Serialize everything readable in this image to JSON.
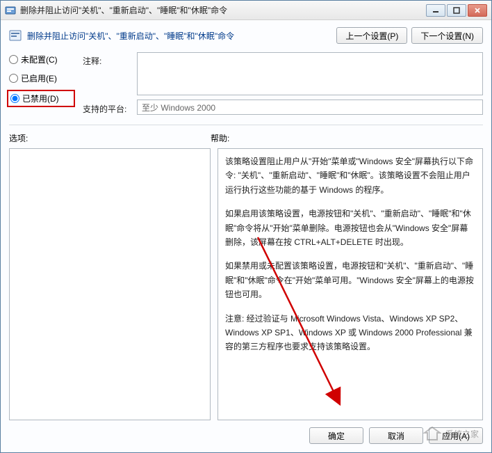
{
  "titlebar": {
    "text": "删除并阻止访问\"关机\"、\"重新启动\"、\"睡眠\"和\"休眠\"命令"
  },
  "header": {
    "title": "删除并阻止访问\"关机\"、\"重新启动\"、\"睡眠\"和\"休眠\"命令",
    "prev_btn": "上一个设置(P)",
    "next_btn": "下一个设置(N)"
  },
  "radios": {
    "not_configured": "未配置(C)",
    "enabled": "已启用(E)",
    "disabled": "已禁用(D)",
    "selected": "disabled"
  },
  "labels": {
    "comment": "注释:",
    "platform": "支持的平台:",
    "options": "选项:",
    "help": "帮助:"
  },
  "platform_value": "至少 Windows 2000",
  "help_paragraphs": [
    "该策略设置阻止用户从\"开始\"菜单或\"Windows 安全\"屏幕执行以下命令: \"关机\"、\"重新启动\"、\"睡眠\"和\"休眠\"。该策略设置不会阻止用户运行执行这些功能的基于 Windows 的程序。",
    "如果启用该策略设置，电源按钮和\"关机\"、\"重新启动\"、\"睡眠\"和\"休眠\"命令将从\"开始\"菜单删除。电源按钮也会从\"Windows 安全\"屏幕删除，该屏幕在按 CTRL+ALT+DELETE 时出现。",
    "如果禁用或未配置该策略设置，电源按钮和\"关机\"、\"重新启动\"、\"睡眠\"和\"休眠\"命令在\"开始\"菜单可用。\"Windows 安全\"屏幕上的电源按钮也可用。",
    "注意: 经过验证与 Microsoft Windows Vista、Windows XP SP2、Windows XP SP1、Windows XP 或 Windows 2000 Professional 兼容的第三方程序也要求支持该策略设置。"
  ],
  "footer": {
    "ok": "确定",
    "cancel": "取消",
    "apply": "应用(A)"
  },
  "watermark": {
    "text": "系统之家"
  }
}
